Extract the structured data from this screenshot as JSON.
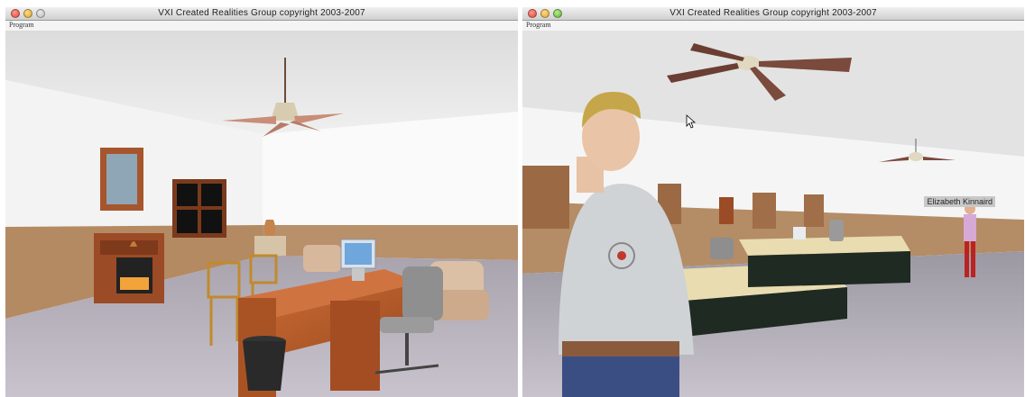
{
  "windows": [
    {
      "title": "VXI Created Realities Group copyright 2003-2007",
      "menu": {
        "program": "Program"
      }
    },
    {
      "title": "VXI Created Realities Group copyright 2003-2007",
      "menu": {
        "program": "Program"
      },
      "avatar_nameplate": "Elizabeth Kinnaird"
    }
  ],
  "colors": {
    "ceiling": "#e6e6e6",
    "wall": "#f4f4f4",
    "wainscot": "#b2865d",
    "carpet": "#b9b3bd",
    "desk_wood": "#b5582a",
    "cabinet_wood": "#9b6a45"
  }
}
